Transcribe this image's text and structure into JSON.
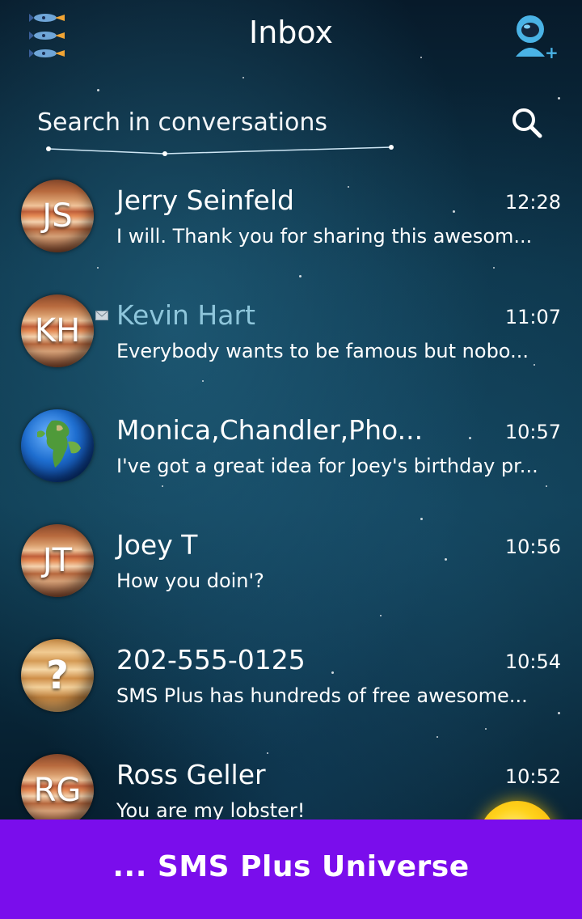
{
  "header": {
    "title": "Inbox",
    "menu_icon": "rockets-menu-icon",
    "add_contact_icon": "astronaut-add-contact-icon"
  },
  "search": {
    "placeholder": "Search in conversations",
    "icon": "search-icon"
  },
  "conversations": [
    {
      "name": "Jerry Seinfeld",
      "time": "12:28",
      "snippet": "I will. Thank you for sharing this awesom...",
      "avatar_text": "JS",
      "avatar_style": "jupiter",
      "unread": false
    },
    {
      "name": "Kevin Hart",
      "time": "11:07",
      "snippet": "Everybody wants to be famous but nobo...",
      "avatar_text": "KH",
      "avatar_style": "jupiter",
      "unread": true
    },
    {
      "name": "Monica,Chandler,Pho...",
      "time": "10:57",
      "snippet": "I've got a great idea for Joey's birthday pr...",
      "avatar_text": "",
      "avatar_style": "earth",
      "unread": false
    },
    {
      "name": "Joey T",
      "time": "10:56",
      "snippet": "How you doin'?",
      "avatar_text": "JT",
      "avatar_style": "jupiter",
      "unread": false
    },
    {
      "name": "202-555-0125",
      "time": "10:54",
      "snippet": "SMS Plus has hundreds of free awesome...",
      "avatar_text": "?",
      "avatar_style": "unknown",
      "unread": false
    },
    {
      "name": "Ross Geller",
      "time": "10:52",
      "snippet": "You are my lobster!",
      "avatar_text": "RG",
      "avatar_style": "jupiter",
      "unread": false
    }
  ],
  "banner": {
    "text": "... SMS Plus Universe"
  },
  "colors": {
    "banner": "#7a0dec",
    "unread_name": "#8ec6db",
    "background": "#0c3348"
  }
}
